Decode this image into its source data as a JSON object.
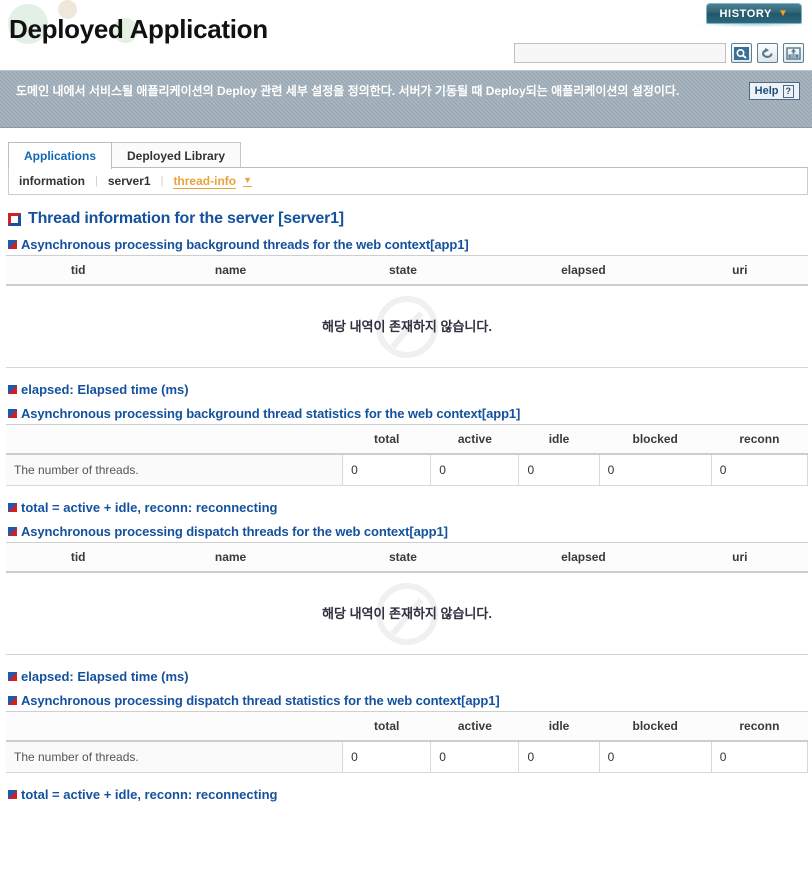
{
  "header": {
    "title": "Deployed Application",
    "history_label": "HISTORY",
    "history_caret": "▼",
    "search_value": "",
    "search_placeholder": "",
    "tools": [
      {
        "name": "search-icon",
        "title": "Search"
      },
      {
        "name": "refresh-icon",
        "title": "Refresh"
      },
      {
        "name": "xml-export-icon",
        "title": "XML"
      }
    ]
  },
  "banner": {
    "text": "도메인 내에서 서비스될 애플리케이션의 Deploy 관련 세부 설정을 정의한다. 서버가 기동될 때 Deploy되는 애플리케이션의 설정이다.",
    "help_label": "Help",
    "help_mark": "?"
  },
  "tabs": [
    {
      "label": "Applications",
      "active": true
    },
    {
      "label": "Deployed Library",
      "active": false
    }
  ],
  "breadcrumb": {
    "items": [
      "information",
      "server1",
      "thread-info"
    ],
    "separator": "|",
    "caret": "▼"
  },
  "main": {
    "title": "Thread information for the server [server1]",
    "sections": [
      {
        "id": "background-threads",
        "heading": "Asynchronous processing background threads for the web context[app1]",
        "type": "empty-table",
        "columns": [
          "tid",
          "name",
          "state",
          "elapsed",
          "uri"
        ],
        "empty_message": "해당 내역이 존재하지 않습니다.",
        "note": "elapsed: Elapsed time (ms)"
      },
      {
        "id": "background-stats",
        "heading": "Asynchronous processing background thread statistics for the web context[app1]",
        "type": "stats-table",
        "columns": [
          "",
          "total",
          "active",
          "idle",
          "blocked",
          "reconn"
        ],
        "rows": [
          {
            "label": "The number of threads.",
            "values": [
              "0",
              "0",
              "0",
              "0",
              "0"
            ]
          }
        ],
        "note": "total = active + idle, reconn: reconnecting"
      },
      {
        "id": "dispatch-threads",
        "heading": "Asynchronous processing dispatch threads for the web context[app1]",
        "type": "empty-table",
        "columns": [
          "tid",
          "name",
          "state",
          "elapsed",
          "uri"
        ],
        "empty_message": "해당 내역이 존재하지 않습니다.",
        "note": "elapsed: Elapsed time (ms)"
      },
      {
        "id": "dispatch-stats",
        "heading": "Asynchronous processing dispatch thread statistics for the web context[app1]",
        "type": "stats-table",
        "columns": [
          "",
          "total",
          "active",
          "idle",
          "blocked",
          "reconn"
        ],
        "rows": [
          {
            "label": "The number of threads.",
            "values": [
              "0",
              "0",
              "0",
              "0",
              "0"
            ]
          }
        ],
        "note": "total = active + idle, reconn: reconnecting"
      }
    ]
  },
  "colors": {
    "heading_blue": "#14519e",
    "accent_orange": "#e8a33d",
    "tab_active": "#1268b3",
    "banner_bg": "#9aa8b4",
    "history_teal": "#2f6274"
  }
}
